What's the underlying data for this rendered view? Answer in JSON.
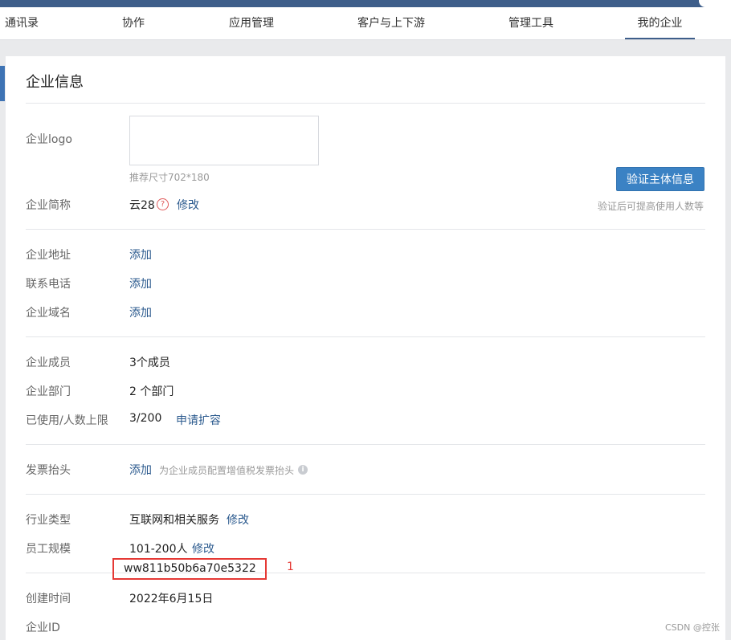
{
  "nav": {
    "items": [
      {
        "label": "通讯录"
      },
      {
        "label": "协作"
      },
      {
        "label": "应用管理"
      },
      {
        "label": "客户与上下游"
      },
      {
        "label": "管理工具"
      },
      {
        "label": "我的企业",
        "active": true
      }
    ]
  },
  "page": {
    "title": "企业信息",
    "logo": {
      "label": "企业logo",
      "hint": "推荐尺寸702*180"
    },
    "verify": {
      "button": "验证主体信息",
      "hint": "验证后可提高使用人数等"
    },
    "short_name": {
      "label": "企业简称",
      "value": "云28",
      "action": "修改"
    },
    "address": {
      "label": "企业地址",
      "action": "添加"
    },
    "phone": {
      "label": "联系电话",
      "action": "添加"
    },
    "domain": {
      "label": "企业域名",
      "action": "添加"
    },
    "members": {
      "label": "企业成员",
      "value": "3个成员"
    },
    "departments": {
      "label": "企业部门",
      "value": "2 个部门"
    },
    "limit": {
      "label": "已使用/人数上限",
      "value": "3/200",
      "action": "申请扩容"
    },
    "invoice": {
      "label": "发票抬头",
      "action": "添加",
      "hint": "为企业成员配置增值税发票抬头"
    },
    "industry": {
      "label": "行业类型",
      "value": "互联网和相关服务",
      "action": "修改"
    },
    "scale": {
      "label": "员工规模",
      "value": "101-200人",
      "action": "修改"
    },
    "created": {
      "label": "创建时间",
      "value": "2022年6月15日"
    },
    "corp_id": {
      "label": "企业ID",
      "value": "ww811b50b6a70e5322"
    }
  },
  "annotation": "1",
  "watermark": "CSDN @控张",
  "colors": {
    "brand": "#3e5e8a",
    "button": "#3b82c4",
    "link": "#2b5a8e",
    "highlight": "#e53935"
  },
  "icons": {
    "help": "question-circle-icon",
    "info": "info-circle-icon"
  }
}
